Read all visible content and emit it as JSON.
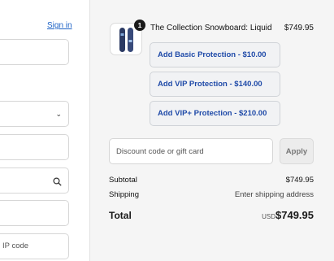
{
  "left": {
    "signin_label": "Sign in",
    "postal_code_placeholder": "IP code",
    "select_icon": "chevron-down-icon",
    "address_icon": "search-icon"
  },
  "summary": {
    "item": {
      "quantity": "1",
      "name": "The Collection Snowboard: Liquid",
      "price": "$749.95"
    },
    "protection_buttons": [
      "Add Basic Protection - $10.00",
      "Add VIP Protection - $140.00",
      "Add VIP+ Protection - $210.00"
    ],
    "discount": {
      "placeholder": "Discount code or gift card",
      "apply_label": "Apply"
    },
    "subtotal_label": "Subtotal",
    "subtotal_value": "$749.95",
    "shipping_label": "Shipping",
    "shipping_value": "Enter shipping address",
    "total_label": "Total",
    "total_currency": "USD",
    "total_value": "$749.95"
  },
  "colors": {
    "link": "#1d62c6",
    "protection_text": "#1f4aa8",
    "summary_bg": "#f5f5f5"
  }
}
